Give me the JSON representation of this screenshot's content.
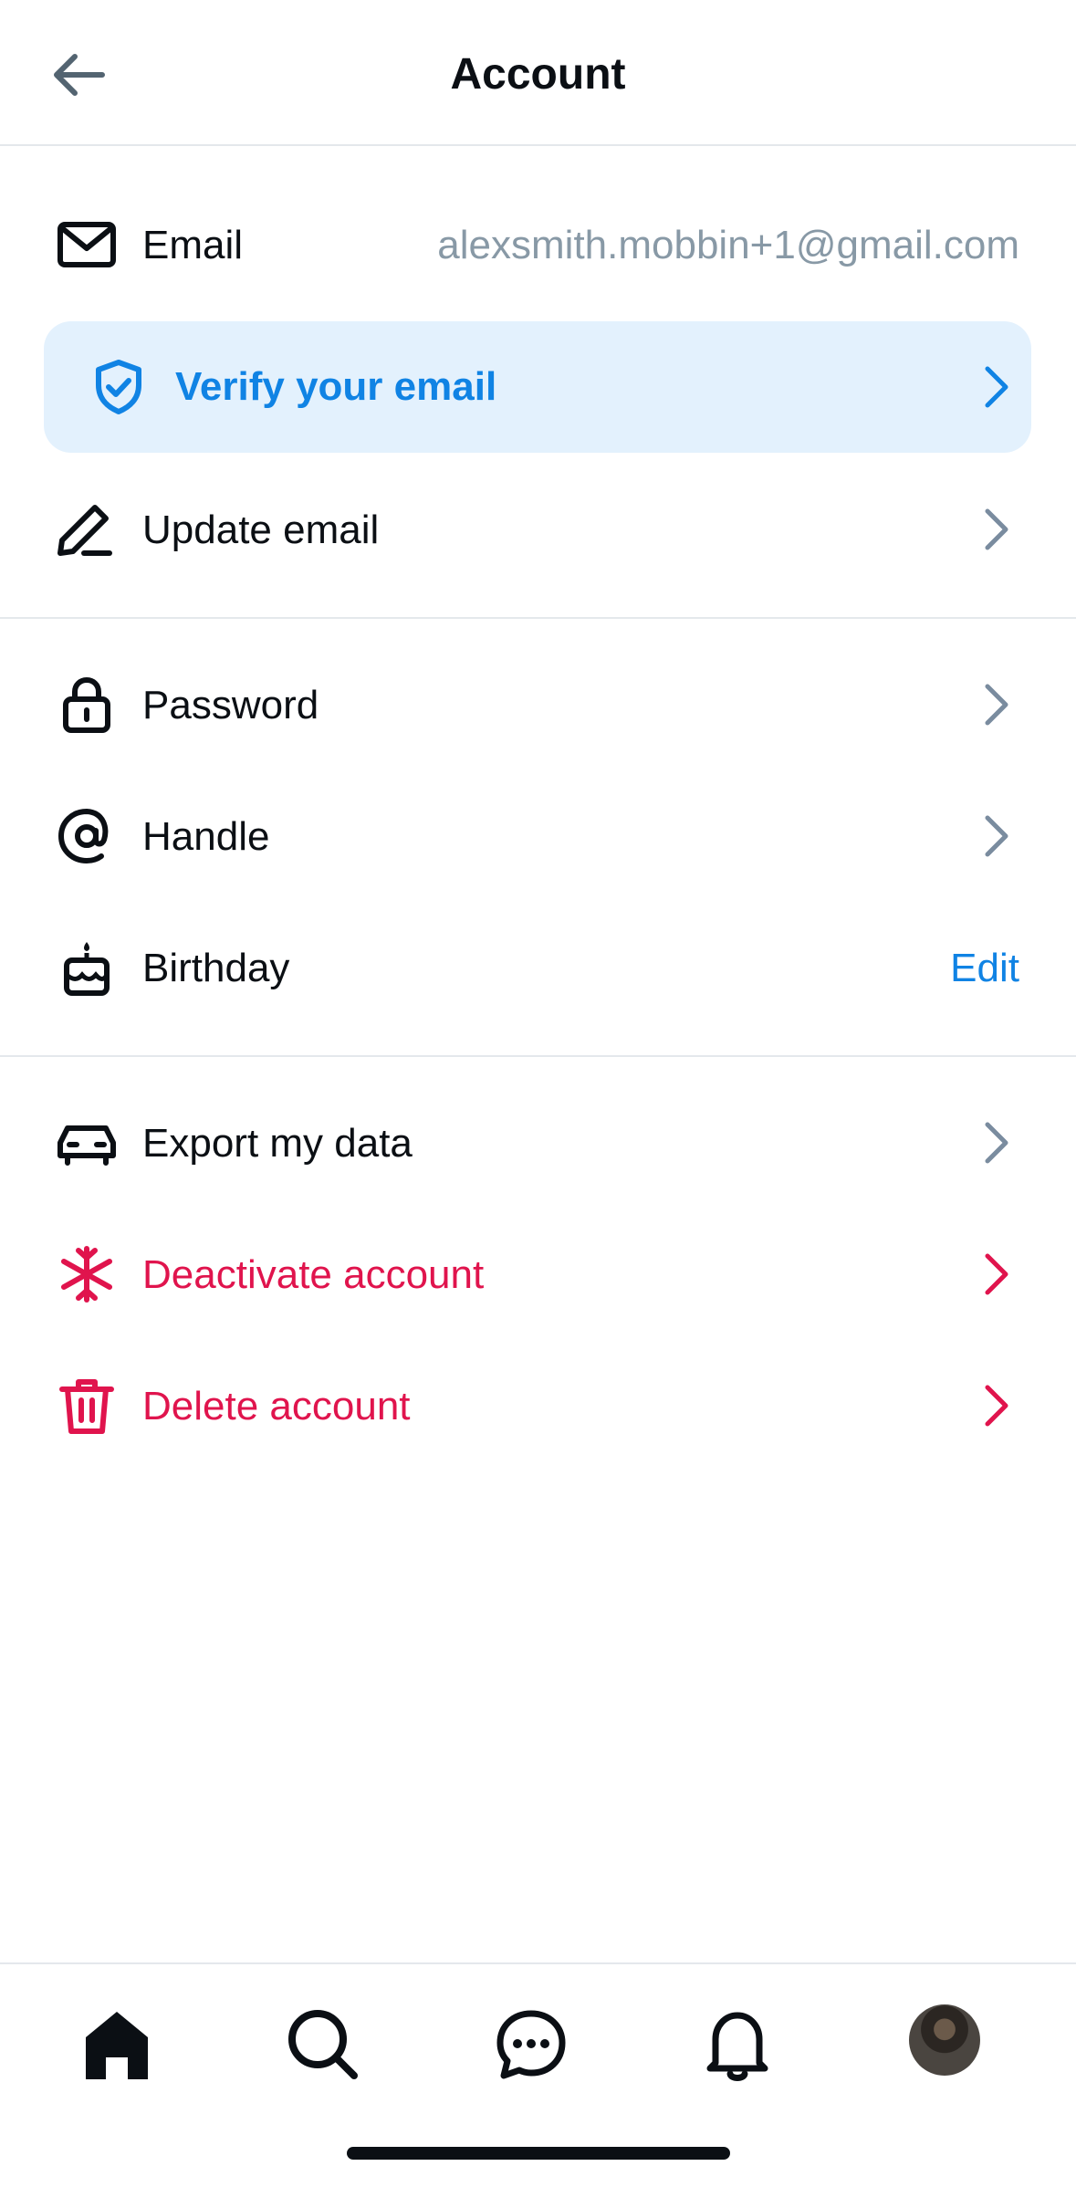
{
  "header": {
    "title": "Account"
  },
  "email_row": {
    "label": "Email",
    "value": "alexsmith.mobbin+1@gmail.com"
  },
  "verify_banner": {
    "label": "Verify your email"
  },
  "rows_group1": {
    "update_email": "Update email"
  },
  "rows_group2": {
    "password": "Password",
    "handle": "Handle",
    "birthday": "Birthday",
    "birthday_action": "Edit"
  },
  "rows_group3": {
    "export": "Export my data",
    "deactivate": "Deactivate account",
    "delete": "Delete account"
  },
  "tabbar": {
    "tabs": [
      "home-icon",
      "search-icon",
      "messages-icon",
      "notifications-icon",
      "profile-avatar"
    ]
  },
  "colors": {
    "accent": "#1083e4",
    "danger": "#e0144d",
    "muted": "#8899a6",
    "verify_bg": "#e3f1fd"
  }
}
